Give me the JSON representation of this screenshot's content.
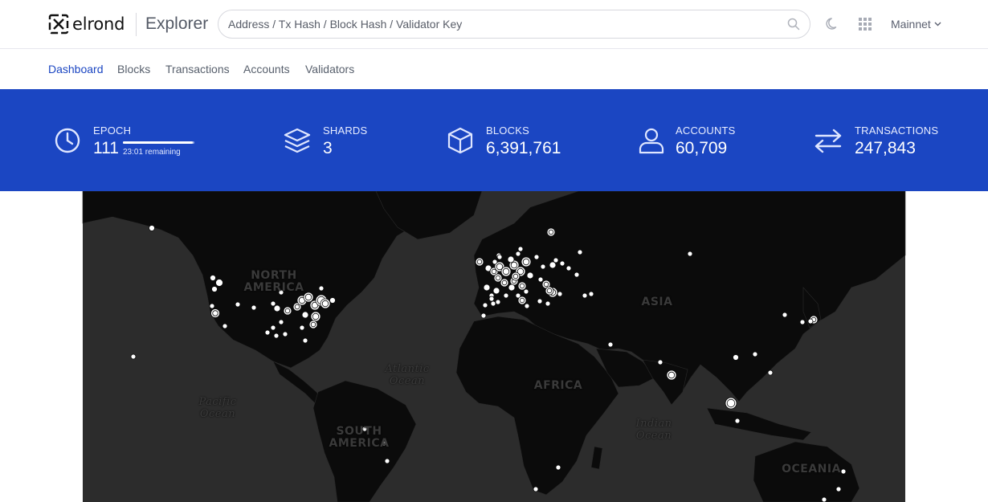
{
  "header": {
    "brand": "elrond",
    "product": "Explorer",
    "search_placeholder": "Address / Tx Hash / Block Hash / Validator Key",
    "network": "Mainnet"
  },
  "nav": {
    "items": [
      {
        "label": "Dashboard",
        "active": true
      },
      {
        "label": "Blocks",
        "active": false
      },
      {
        "label": "Transactions",
        "active": false
      },
      {
        "label": "Accounts",
        "active": false
      },
      {
        "label": "Validators",
        "active": false
      }
    ]
  },
  "stats": {
    "epoch": {
      "label": "EPOCH",
      "value": "111",
      "remaining": "23:01 remaining",
      "progress": 0.98
    },
    "shards": {
      "label": "SHARDS",
      "value": "3"
    },
    "blocks": {
      "label": "BLOCKS",
      "value": "6,391,761"
    },
    "accounts": {
      "label": "ACCOUNTS",
      "value": "60,709"
    },
    "transactions": {
      "label": "TRANSACTIONS",
      "value": "247,843"
    }
  },
  "map": {
    "continent_labels": {
      "north_america": "NORTH AMERICA",
      "south_america": "SOUTH AMERICA",
      "africa": "AFRICA",
      "asia": "ASIA",
      "oceania": "OCEANIA"
    },
    "ocean_labels": {
      "atlantic": "Atlantic Ocean",
      "pacific": "Pacific Ocean",
      "indian": "Indian Ocean"
    }
  },
  "colors": {
    "brand_blue": "#1b46c2",
    "active_nav": "#1b46c2",
    "map_land": "#0b0b0b",
    "map_ocean": "#2c2c2c",
    "node_marker": "#ffffff"
  },
  "icons": {
    "search": "search-icon",
    "theme": "moon-icon",
    "apps": "grid-icon",
    "epoch": "clock-icon",
    "shards": "layers-icon",
    "blocks": "cube-icon",
    "accounts": "user-icon",
    "transactions": "arrows-icon"
  }
}
